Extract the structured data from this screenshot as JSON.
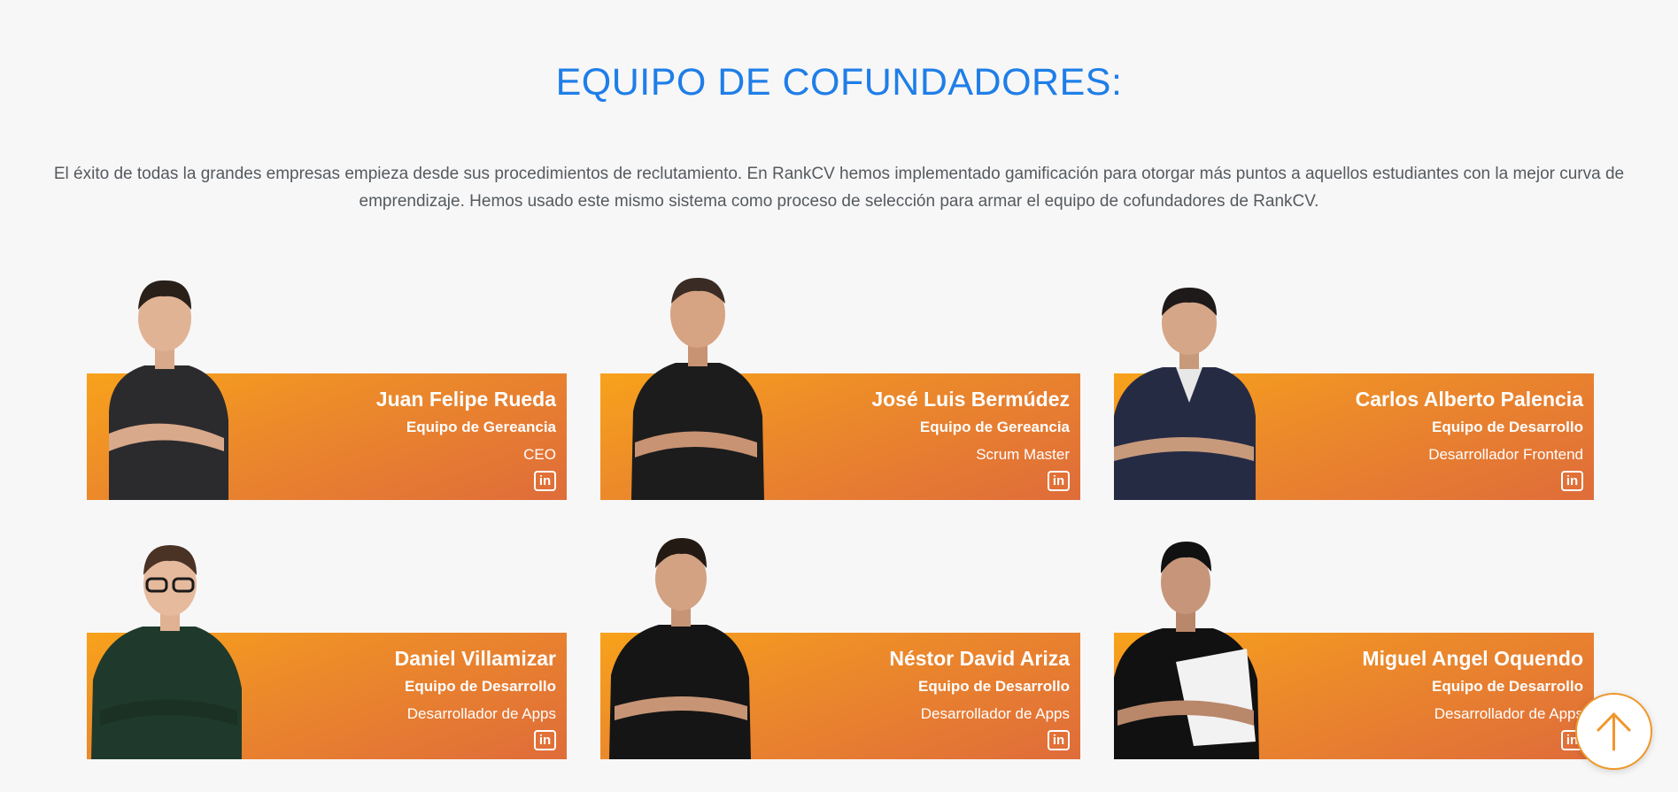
{
  "section": {
    "title": "EQUIPO DE COFUNDADORES:",
    "intro": "El éxito de todas la grandes empresas empieza desde sus procedimientos de reclutamiento. En RankCV hemos implementado gamificación para otorgar más puntos a aquellos estudiantes con la mejor curva de emprendizaje. Hemos usado este mismo sistema como proceso de selección para armar el equipo de cofundadores de RankCV."
  },
  "team": [
    {
      "name": "Juan Felipe Rueda",
      "team": "Equipo de Gereancia",
      "role": "CEO",
      "shirt": "#2b2b2e",
      "link_icon": "linkedin-icon"
    },
    {
      "name": "José Luis Bermúdez",
      "team": "Equipo de Gereancia",
      "role": "Scrum Master",
      "shirt": "#1c1c1c",
      "link_icon": "linkedin-icon"
    },
    {
      "name": "Carlos Alberto Palencia",
      "team": "Equipo de Desarrollo",
      "role": "Desarrollador Frontend",
      "shirt": "#262b44",
      "link_icon": "linkedin-icon"
    },
    {
      "name": "Daniel Villamizar",
      "team": "Equipo de Desarrollo",
      "role": "Desarrollador de Apps",
      "shirt": "#1f3a2c",
      "link_icon": "linkedin-icon"
    },
    {
      "name": "Néstor David Ariza",
      "team": "Equipo de Desarrollo",
      "role": "Desarrollador de Apps",
      "shirt": "#151515",
      "link_icon": "linkedin-icon"
    },
    {
      "name": "Miguel Angel Oquendo",
      "team": "Equipo de Desarrollo",
      "role": "Desarrollador de Apps",
      "shirt": "#111111",
      "link_icon": "linkedin-icon"
    }
  ],
  "linkedin_label": "in",
  "colors": {
    "title": "#1f7ee8",
    "card_gradient_start": "#f8a21b",
    "card_gradient_end": "#df6c3a",
    "scroll_top_accent": "#f0962a"
  },
  "scroll_top_icon": "arrow-up-icon"
}
